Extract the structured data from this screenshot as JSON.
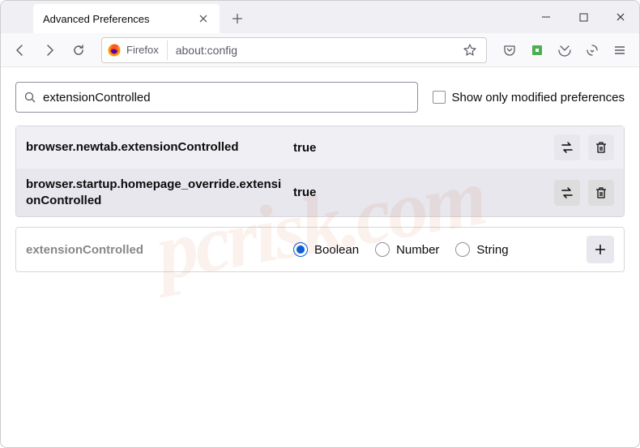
{
  "tab": {
    "title": "Advanced Preferences"
  },
  "urlbar": {
    "identity_label": "Firefox",
    "url": "about:config"
  },
  "search": {
    "value": "extensionControlled",
    "checkbox_label": "Show only modified preferences"
  },
  "prefs": [
    {
      "name": "browser.newtab.extensionControlled",
      "value": "true"
    },
    {
      "name": "browser.startup.homepage_override.extensionControlled",
      "value": "true"
    }
  ],
  "new_pref": {
    "name": "extensionControlled",
    "types": [
      "Boolean",
      "Number",
      "String"
    ],
    "selected": "Boolean"
  },
  "watermark": "pcrisk.com"
}
